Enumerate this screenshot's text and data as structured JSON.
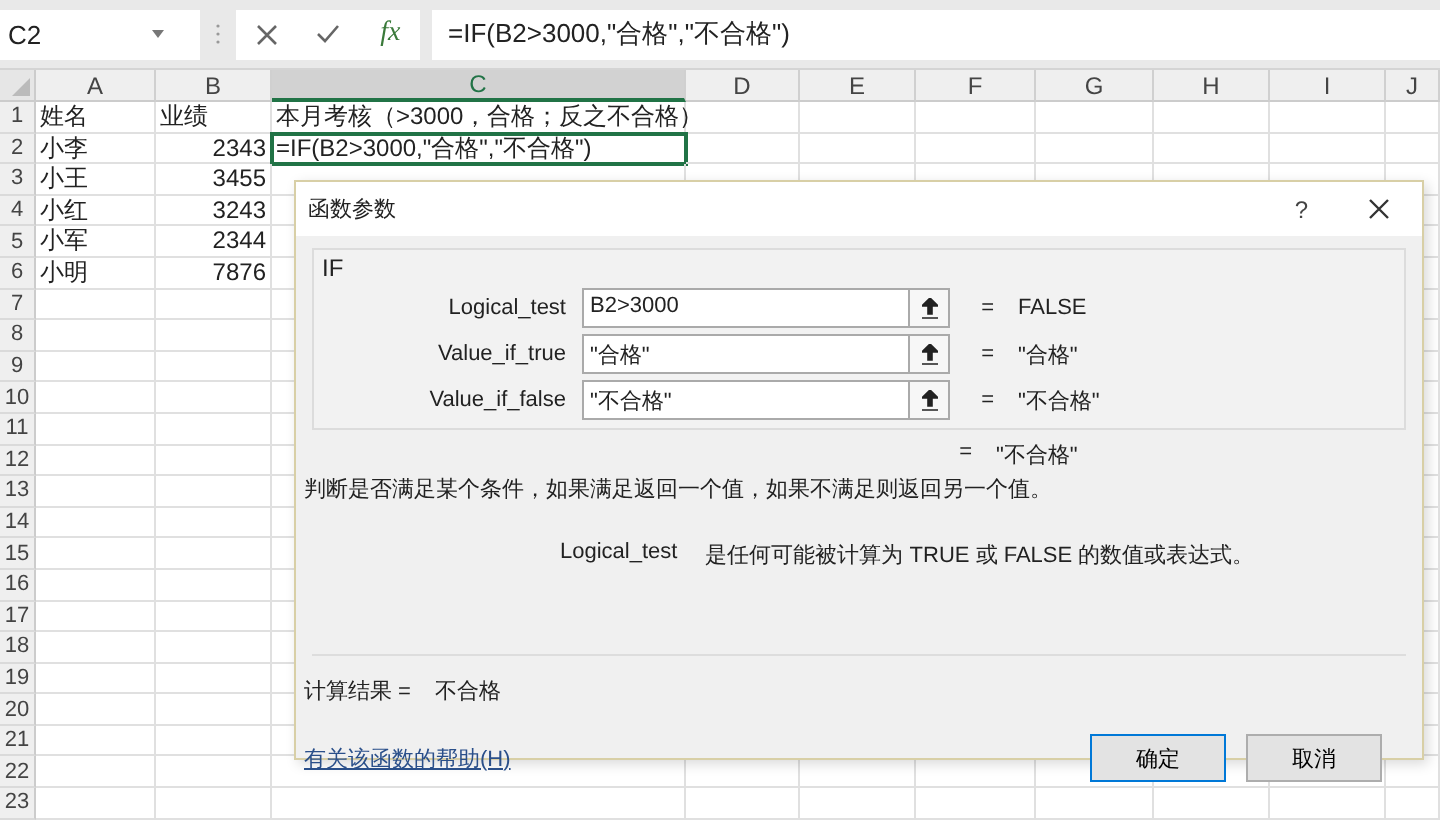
{
  "formula_bar": {
    "name_box": "C2",
    "function_button": "fx",
    "formula": "=IF(B2>3000,\"合格\",\"不合格\")"
  },
  "sheet": {
    "columns": [
      {
        "label": "A",
        "selected": false
      },
      {
        "label": "B",
        "selected": false
      },
      {
        "label": "C",
        "selected": true
      },
      {
        "label": "D",
        "selected": false
      },
      {
        "label": "E",
        "selected": false
      },
      {
        "label": "F",
        "selected": false
      },
      {
        "label": "G",
        "selected": false
      },
      {
        "label": "H",
        "selected": false
      },
      {
        "label": "I",
        "selected": false
      },
      {
        "label": "J",
        "selected": false
      }
    ],
    "rows": [
      {
        "number": "1",
        "cells": [
          {
            "text": "姓名",
            "kind": "text",
            "selected": false
          },
          {
            "text": "业绩",
            "kind": "text",
            "selected": false
          },
          {
            "text": "本月考核（>3000，合格；反之不合格）",
            "kind": "text",
            "selected": false
          }
        ]
      },
      {
        "number": "2",
        "cells": [
          {
            "text": "小李",
            "kind": "text",
            "selected": false
          },
          {
            "text": "2343",
            "kind": "number",
            "selected": false
          },
          {
            "text": "=IF(B2>3000,\"合格\",\"不合格\")",
            "kind": "text",
            "selected": true
          }
        ]
      },
      {
        "number": "3",
        "cells": [
          {
            "text": "小王",
            "kind": "text",
            "selected": false
          },
          {
            "text": "3455",
            "kind": "number",
            "selected": false
          }
        ]
      },
      {
        "number": "4",
        "cells": [
          {
            "text": "小红",
            "kind": "text",
            "selected": false
          },
          {
            "text": "3243",
            "kind": "number",
            "selected": false
          }
        ]
      },
      {
        "number": "5",
        "cells": [
          {
            "text": "小军",
            "kind": "text",
            "selected": false
          },
          {
            "text": "2344",
            "kind": "number",
            "selected": false
          }
        ]
      },
      {
        "number": "6",
        "cells": [
          {
            "text": "小明",
            "kind": "text",
            "selected": false
          },
          {
            "text": "7876",
            "kind": "number",
            "selected": false
          }
        ]
      },
      {
        "number": "7",
        "cells": []
      },
      {
        "number": "8",
        "cells": []
      },
      {
        "number": "9",
        "cells": []
      },
      {
        "number": "10",
        "cells": []
      },
      {
        "number": "11",
        "cells": []
      },
      {
        "number": "12",
        "cells": []
      },
      {
        "number": "13",
        "cells": []
      },
      {
        "number": "14",
        "cells": []
      },
      {
        "number": "15",
        "cells": []
      },
      {
        "number": "16",
        "cells": []
      },
      {
        "number": "17",
        "cells": []
      },
      {
        "number": "18",
        "cells": []
      },
      {
        "number": "19",
        "cells": []
      },
      {
        "number": "20",
        "cells": []
      },
      {
        "number": "21",
        "cells": []
      },
      {
        "number": "22",
        "cells": []
      },
      {
        "number": "23",
        "cells": []
      }
    ]
  },
  "dialog": {
    "title": "函数参数",
    "help": "?",
    "function_name": "IF",
    "arguments": [
      {
        "label": "Logical_test",
        "value": "B2>3000",
        "equals": "=",
        "result": "FALSE"
      },
      {
        "label": "Value_if_true",
        "value": "\"合格\"",
        "equals": "=",
        "result": "\"合格\""
      },
      {
        "label": "Value_if_false",
        "value": "\"不合格\"",
        "equals": "=",
        "result": "\"不合格\""
      }
    ],
    "overall_equals": "=",
    "overall_result": "\"不合格\"",
    "description": "判断是否满足某个条件，如果满足返回一个值，如果不满足则返回另一个值。",
    "argument_help_name": "Logical_test",
    "argument_help_text": "是任何可能被计算为 TRUE 或 FALSE 的数值或表达式。",
    "calc_result_label": "计算结果 =",
    "calc_result_value": "不合格",
    "help_link": "有关该函数的帮助(H)",
    "buttons": [
      {
        "label": "确定",
        "default": true
      },
      {
        "label": "取消",
        "default": false
      }
    ]
  }
}
